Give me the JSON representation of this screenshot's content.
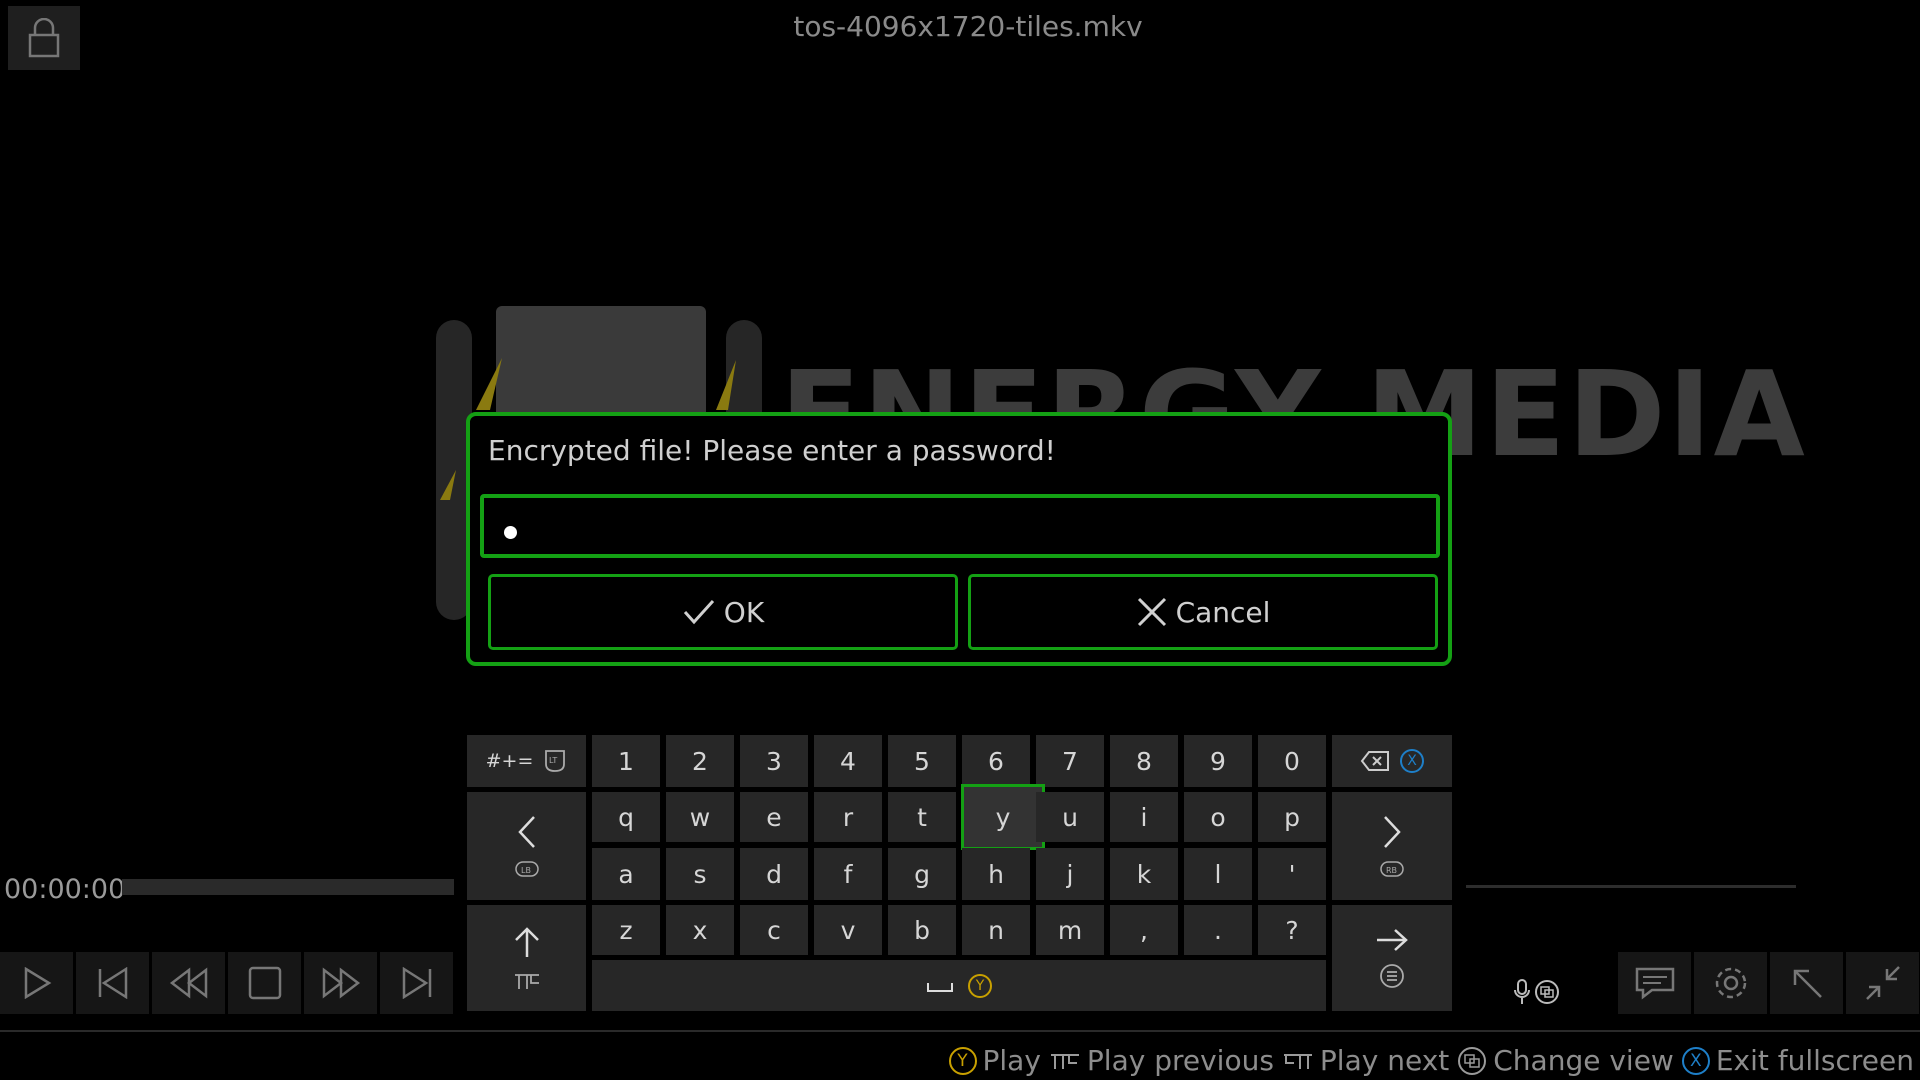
{
  "window": {
    "title": "tos-4096x1720-tiles.mkv"
  },
  "background_logo": {
    "text": "ENERGY MEDIA"
  },
  "player": {
    "time": "00:00:00",
    "progress": 0
  },
  "dialog": {
    "message": "Encrypted file! Please enter a password!",
    "password_mask": "●",
    "ok_label": "OK",
    "cancel_label": "Cancel"
  },
  "keyboard": {
    "symbols_label": "#+=",
    "numbers": [
      "1",
      "2",
      "3",
      "4",
      "5",
      "6",
      "7",
      "8",
      "9",
      "0"
    ],
    "row1": [
      "q",
      "w",
      "e",
      "r",
      "t",
      "y",
      "u",
      "i",
      "o",
      "p"
    ],
    "row2": [
      "a",
      "s",
      "d",
      "f",
      "g",
      "h",
      "j",
      "k",
      "l",
      "'"
    ],
    "row3": [
      "z",
      "x",
      "c",
      "v",
      "b",
      "n",
      "m",
      ",",
      ".",
      "?"
    ],
    "selected_key": "y",
    "space_label": "␣"
  },
  "hints": [
    {
      "button": "Y",
      "label": "Play",
      "color": "#c8a000"
    },
    {
      "button": "LB",
      "label": "Play previous"
    },
    {
      "button": "RB",
      "label": "Play next"
    },
    {
      "button": "view",
      "label": "Change view"
    },
    {
      "button": "X",
      "label": "Exit fullscreen",
      "color": "#1e7fc8"
    }
  ],
  "colors": {
    "accent": "#14a014",
    "y_button": "#c8a000",
    "x_button": "#1e7fc8"
  }
}
